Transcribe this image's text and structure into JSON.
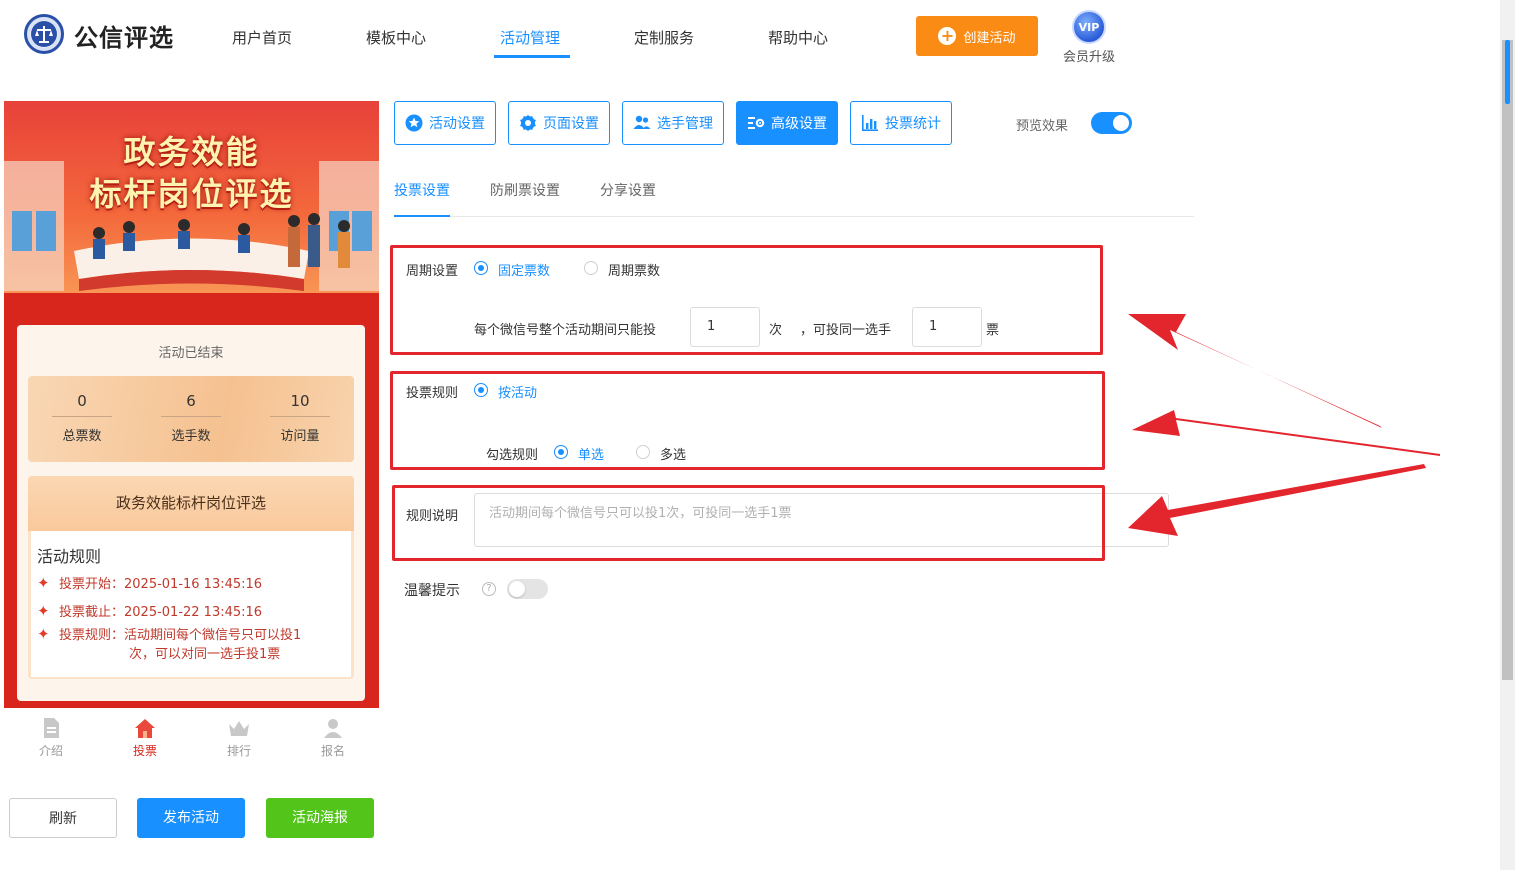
{
  "header": {
    "logo_text": "公信评选",
    "nav": [
      "用户首页",
      "模板中心",
      "活动管理",
      "定制服务",
      "帮助中心"
    ],
    "create_label": "创建活动",
    "vip_badge": "VIP",
    "vip_label": "会员升级"
  },
  "preview": {
    "banner_line1": "政务效能",
    "banner_line2": "标杆岗位评选",
    "status": "活动已结束",
    "stats": [
      {
        "value": "0",
        "label": "总票数"
      },
      {
        "value": "6",
        "label": "选手数"
      },
      {
        "value": "10",
        "label": "访问量"
      }
    ],
    "event_title": "政务效能标杆岗位评选",
    "rules_caption": "活动规则",
    "rule_start": "投票开始：2025-01-16 13:45:16",
    "rule_end": "投票截止：2025-01-22 13:45:16",
    "rule_desc_1": "投票规则：活动期间每个微信号只可以投1",
    "rule_desc_2": "次，可以对同一选手投1票",
    "tabs": [
      {
        "label": "介绍",
        "icon": "document-icon"
      },
      {
        "label": "投票",
        "icon": "home-icon"
      },
      {
        "label": "排行",
        "icon": "crown-icon"
      },
      {
        "label": "报名",
        "icon": "user-icon"
      }
    ]
  },
  "actions": {
    "refresh": "刷新",
    "publish": "发布活动",
    "poster": "活动海报"
  },
  "settings_tabs": [
    {
      "label": "活动设置",
      "icon": "star-icon"
    },
    {
      "label": "页面设置",
      "icon": "gear-icon"
    },
    {
      "label": "选手管理",
      "icon": "users-icon"
    },
    {
      "label": "高级设置",
      "icon": "sliders-icon"
    },
    {
      "label": "投票统计",
      "icon": "bar-chart-icon"
    }
  ],
  "preview_toggle_label": "预览效果",
  "subtabs": [
    "投票设置",
    "防刷票设置",
    "分享设置"
  ],
  "period": {
    "label": "周期设置",
    "opt_fixed": "固定票数",
    "opt_period": "周期票数",
    "sentence_a": "每个微信号整个活动期间只能投",
    "times_value": "1",
    "sentence_b": "次",
    "sentence_c": "，可投同一选手",
    "votes_value": "1",
    "sentence_d": "票"
  },
  "vote_rule": {
    "label": "投票规则",
    "opt_by_activity": "按活动",
    "check_label": "勾选规则",
    "opt_single": "单选",
    "opt_multi": "多选"
  },
  "rule_desc": {
    "label": "规则说明",
    "placeholder": "活动期间每个微信号只可以投1次，可投同一选手1票"
  },
  "tip": {
    "label": "温馨提示",
    "help": "?"
  },
  "colors": {
    "accent": "#1890ff",
    "orange": "#fa8c16",
    "green": "#52c41a",
    "highlight": "#e3262d"
  }
}
